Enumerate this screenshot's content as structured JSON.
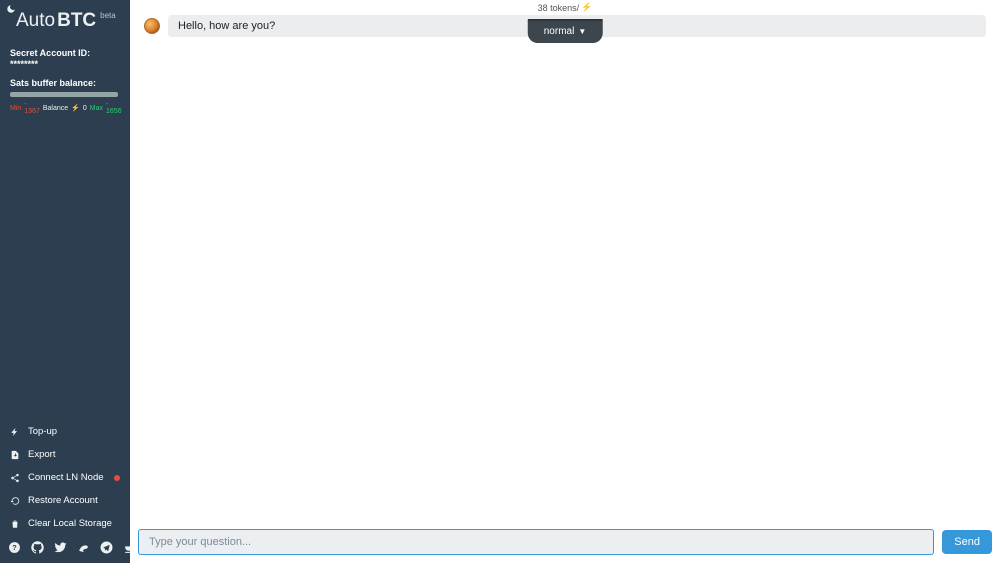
{
  "brand": {
    "a": "Auto",
    "b": "BTC",
    "beta": "beta"
  },
  "account": {
    "label": "Secret Account ID: ",
    "masked": "********"
  },
  "buffer": {
    "label": "Sats buffer balance:",
    "min_word": "Min",
    "min_val": "- 1367",
    "bal_word": "Balance",
    "sat_glyph": "⚡",
    "bal_val": "0",
    "max_word": "Max",
    "max_val": "- 1656"
  },
  "menu": {
    "topup": "Top-up",
    "export": "Export",
    "connect": "Connect LN Node",
    "restore": "Restore Account",
    "clear": "Clear Local Storage"
  },
  "tokens": {
    "text": "38 tokens/",
    "sat": "⚡"
  },
  "message": "Hello, how are you?",
  "mode": {
    "label": "normal",
    "caret": "▼"
  },
  "input": {
    "placeholder": "Type your question...",
    "send": "Send"
  }
}
